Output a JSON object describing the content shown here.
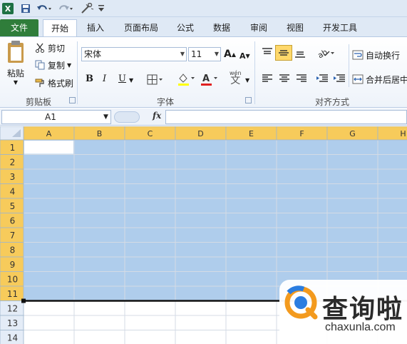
{
  "qat": {
    "excel_icon": "excel-logo-icon",
    "icons": [
      "save-icon",
      "undo-icon",
      "redo-icon",
      "customize-icon"
    ]
  },
  "tabs": [
    {
      "label": "文件"
    },
    {
      "label": "开始"
    },
    {
      "label": "插入"
    },
    {
      "label": "页面布局"
    },
    {
      "label": "公式"
    },
    {
      "label": "数据"
    },
    {
      "label": "审阅"
    },
    {
      "label": "视图"
    },
    {
      "label": "开发工具"
    }
  ],
  "ribbon": {
    "clipboard": {
      "paste": "粘贴",
      "cut": "剪切",
      "copy": "复制",
      "format_painter": "格式刷",
      "group_label": "剪贴板"
    },
    "font": {
      "font_name": "宋体",
      "font_size": "11",
      "bold": "B",
      "italic": "I",
      "underline": "U",
      "wen": "wén",
      "group_label": "字体"
    },
    "alignment": {
      "wrap_text": "自动换行",
      "merge_center": "合并后居中",
      "group_label": "对齐方式"
    }
  },
  "formula_bar": {
    "name_box": "A1",
    "fx": "fx",
    "content": ""
  },
  "sheet": {
    "columns": [
      "A",
      "B",
      "C",
      "D",
      "E",
      "F",
      "G",
      "H"
    ],
    "rows": [
      "1",
      "2",
      "3",
      "4",
      "5",
      "6",
      "7",
      "8",
      "9",
      "10",
      "11",
      "12",
      "13",
      "14"
    ],
    "selected_range": "A1:H11",
    "active_cell": "A1",
    "colors": {
      "selection": "#afcdec",
      "header_selected": "#f7cb5b",
      "header": "#e4ecf7"
    }
  },
  "watermark": {
    "text": "查询啦",
    "url": "chaxunla.com"
  }
}
